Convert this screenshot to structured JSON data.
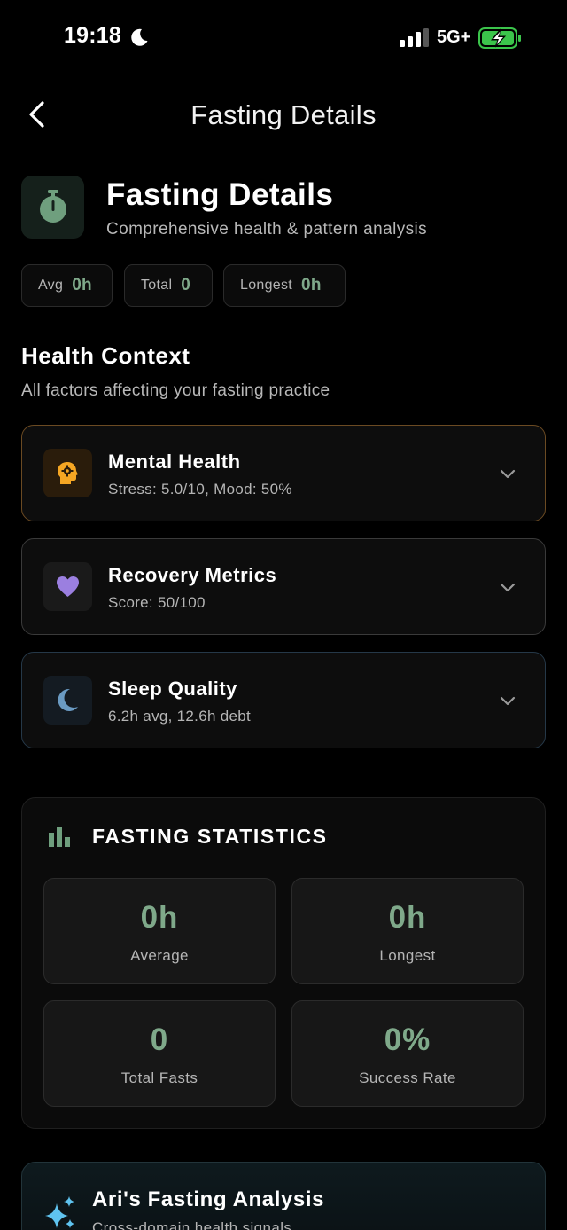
{
  "status_bar": {
    "time": "19:18",
    "network": "5G+"
  },
  "nav": {
    "title": "Fasting Details"
  },
  "hero": {
    "title": "Fasting Details",
    "subtitle": "Comprehensive health & pattern analysis",
    "icon": "stopwatch-icon"
  },
  "summary_chips": [
    {
      "label": "Avg",
      "value": "0h"
    },
    {
      "label": "Total",
      "value": "0"
    },
    {
      "label": "Longest",
      "value": "0h"
    }
  ],
  "health_context": {
    "heading": "Health Context",
    "description": "All factors affecting your fasting practice",
    "cards": [
      {
        "title": "Mental Health",
        "subtitle": "Stress: 5.0/10, Mood: 50%",
        "icon": "brain-head-icon",
        "accent": "#f5a623"
      },
      {
        "title": "Recovery Metrics",
        "subtitle": "Score: 50/100",
        "icon": "heart-icon",
        "accent": "#9b7fe0"
      },
      {
        "title": "Sleep Quality",
        "subtitle": "6.2h avg, 12.6h debt",
        "icon": "crescent-moon-icon",
        "accent": "#6a9ac2"
      }
    ]
  },
  "statistics": {
    "title": "FASTING STATISTICS",
    "icon": "bar-chart-icon",
    "tiles": [
      {
        "value": "0h",
        "label": "Average"
      },
      {
        "value": "0h",
        "label": "Longest"
      },
      {
        "value": "0",
        "label": "Total Fasts"
      },
      {
        "value": "0%",
        "label": "Success Rate"
      }
    ]
  },
  "analysis": {
    "title": "Ari's Fasting Analysis",
    "subtitle": "Cross-domain health signals",
    "icon": "sparkle-icon"
  },
  "colors": {
    "accent_green": "#7fa98a",
    "background": "#000000",
    "card_background": "#0d0d0d"
  }
}
